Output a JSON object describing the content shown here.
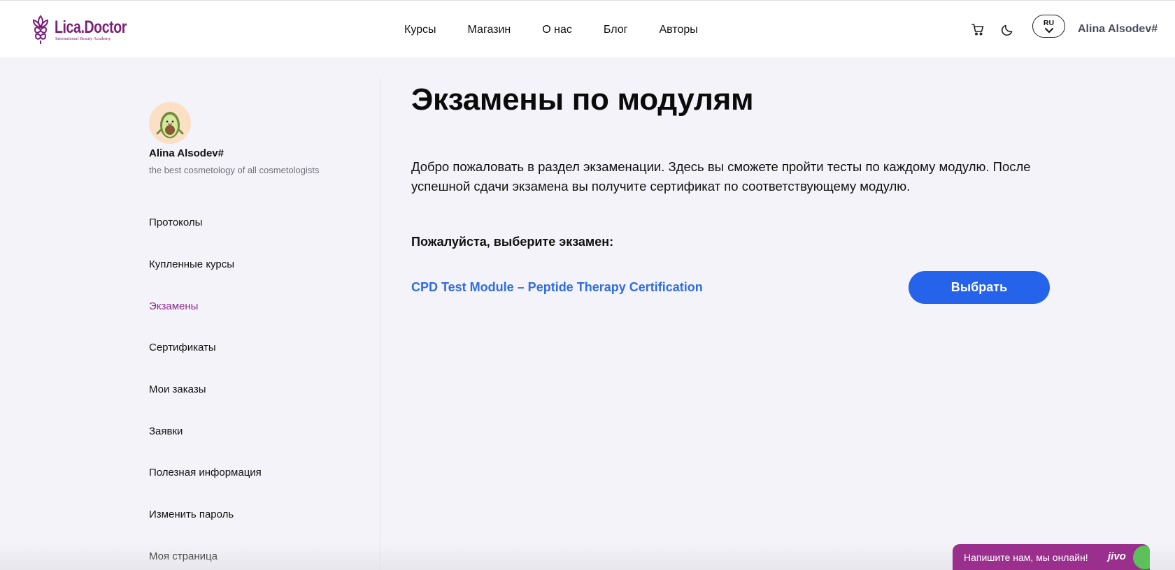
{
  "brand": {
    "name": "Lica.Doctor",
    "tagline": "International Beauty Academy",
    "color": "#7b1f78"
  },
  "nav": {
    "items": [
      "Курсы",
      "Магазин",
      "О нас",
      "Блог",
      "Авторы"
    ]
  },
  "header": {
    "cart_icon": "cart-icon",
    "theme_icon": "moon-icon",
    "language": "RU",
    "user_name": "Alina Alsodev#"
  },
  "profile": {
    "name": "Alina Alsodev#",
    "subtitle": "the best cosmetology of all cosmetologists",
    "avatar_icon": "avocado-avatar"
  },
  "sidebar": {
    "items": [
      {
        "label": "Протоколы",
        "active": false
      },
      {
        "label": "Купленные курсы",
        "active": false
      },
      {
        "label": "Экзамены",
        "active": true
      },
      {
        "label": "Сертификаты",
        "active": false
      },
      {
        "label": "Мои заказы",
        "active": false
      },
      {
        "label": "Заявки",
        "active": false
      },
      {
        "label": "Полезная информация",
        "active": false
      },
      {
        "label": "Изменить пароль",
        "active": false
      },
      {
        "label": "Моя страница",
        "active": false
      }
    ],
    "active_color": "#8e2c8a"
  },
  "main": {
    "title": "Экзамены по модулям",
    "intro": "Добро пожаловать в раздел экзаменации. Здесь вы сможете пройти тесты по каждому модулю. После успешной сдачи экзамена вы получите сертификат по соответствующему модулю.",
    "choose_label": "Пожалуйста, выберите экзамен:",
    "exams": [
      {
        "title": "CPD Test Module – Peptide Therapy Certification",
        "button": "Выбрать"
      }
    ],
    "accent_color": "#2563eb"
  },
  "chat": {
    "text": "Напишите нам, мы онлайн!",
    "brand": "jivo",
    "color": "#9b2f8e"
  }
}
